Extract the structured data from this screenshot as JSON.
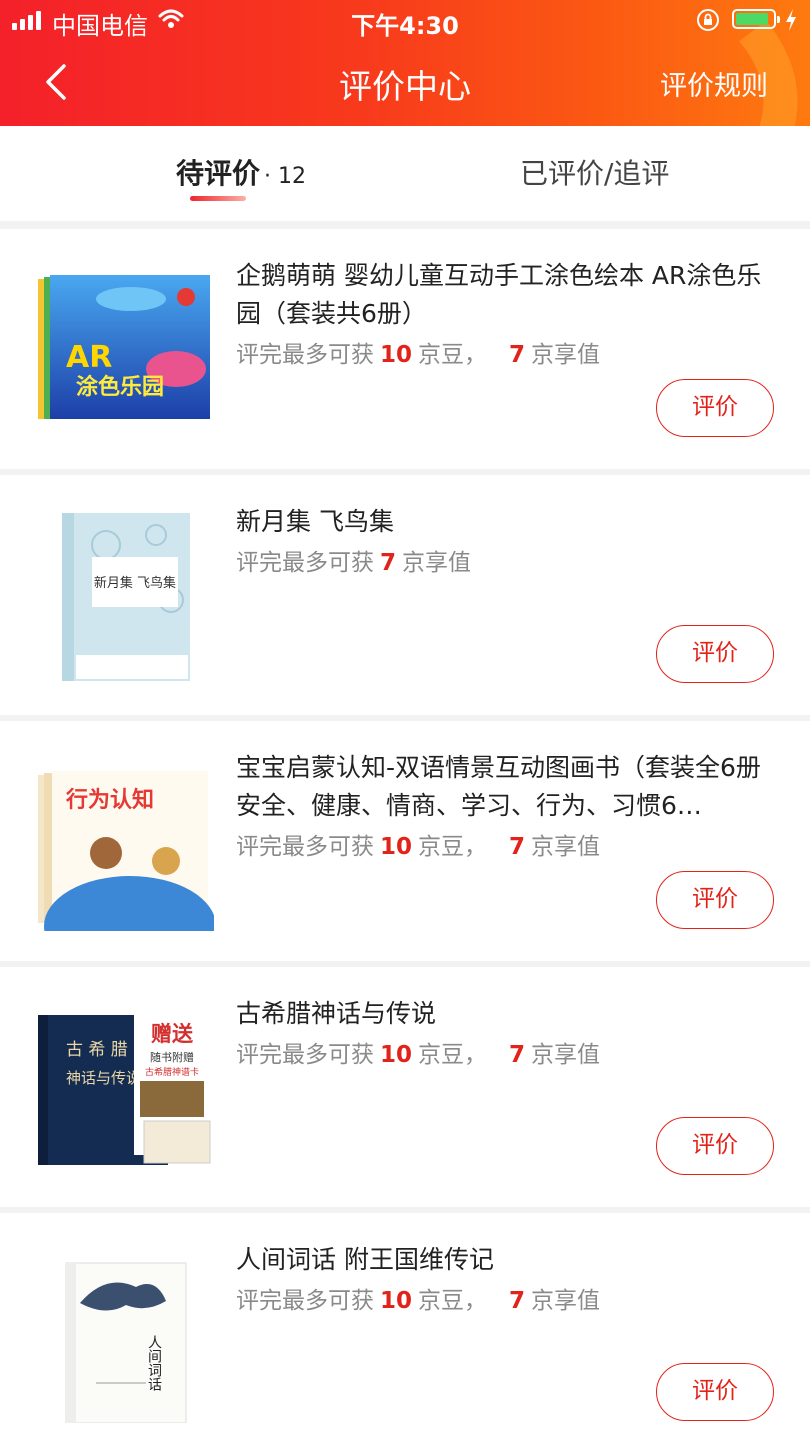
{
  "status_bar": {
    "carrier": "中国电信",
    "time": "下午4:30"
  },
  "header": {
    "title": "评价中心",
    "rules_label": "评价规则"
  },
  "tabs": {
    "pending_label": "待评价",
    "pending_count": "· 12",
    "done_label": "已评价/追评"
  },
  "reward_text": {
    "prefix": "评完最多可获",
    "beans": "京豆，",
    "value": "京享值"
  },
  "items": [
    {
      "title": "企鹅萌萌 婴幼儿童互动手工涂色绘本 AR涂色乐园（套装共6册）",
      "beans": "10",
      "value": "7",
      "button": "评价"
    },
    {
      "title": "新月集 飞鸟集",
      "value": "7",
      "button": "评价"
    },
    {
      "title": "宝宝启蒙认知-双语情景互动图画书（套装全6册 安全、健康、情商、学习、行为、习惯6…",
      "beans": "10",
      "value": "7",
      "button": "评价"
    },
    {
      "title": "古希腊神话与传说",
      "beans": "10",
      "value": "7",
      "button": "评价"
    },
    {
      "title": "人间词话 附王国维传记",
      "beans": "10",
      "value": "7",
      "button": "评价"
    }
  ],
  "covers": {
    "ar": {
      "big": "AR",
      "sub": "涂色乐园"
    },
    "moon": {
      "title": "新月集 飞鸟集"
    },
    "behavior": {
      "title": "行为认知"
    },
    "greek": {
      "title": "古 希 腊",
      "subtitle": "神话与传说",
      "gift": "赠送",
      "gift_line1": "随书附赠",
      "gift_line2": "古希腊神谱卡"
    },
    "cihua": {
      "title": "人间词话"
    }
  },
  "colors": {
    "accent": "#e2231a",
    "header_start": "#f4202a",
    "header_end": "#fe7a10"
  }
}
